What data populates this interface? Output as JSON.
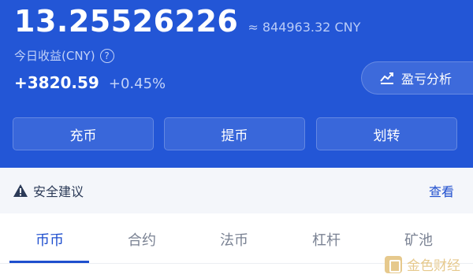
{
  "balance": {
    "amount": "13.25526226",
    "approx_cny": "≈ 844963.32 CNY"
  },
  "income": {
    "label": "今日收益(CNY)",
    "amount": "+3820.59",
    "percent": "+0.45%"
  },
  "profit_loss_button": {
    "label": "盈亏分析"
  },
  "actions": [
    {
      "label": "充币"
    },
    {
      "label": "提币"
    },
    {
      "label": "划转"
    }
  ],
  "advice": {
    "label": "安全建议",
    "link": "查看"
  },
  "tabs": [
    {
      "label": "币币",
      "active": true
    },
    {
      "label": "合约"
    },
    {
      "label": "法币"
    },
    {
      "label": "杠杆"
    },
    {
      "label": "矿池"
    }
  ],
  "watermark": {
    "text": "金色财经"
  },
  "colors": {
    "hero_bg": "#2356d6",
    "accent": "#1f4fce",
    "advice_bg": "#f4f6fa"
  }
}
